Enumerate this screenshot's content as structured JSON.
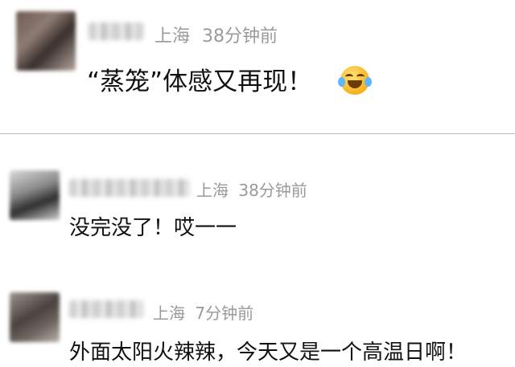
{
  "comments": [
    {
      "location": "上海",
      "time": "38分钟前",
      "text": "“蒸笼”体感又再现！",
      "emoji": "laughing-crying-emoji"
    },
    {
      "location": "上海",
      "time": "38分钟前",
      "text": "没完没了！哎一一"
    },
    {
      "location": "上海",
      "time": "7分钟前",
      "text": "外面太阳火辣辣，今天又是一个高温日啊！"
    }
  ]
}
